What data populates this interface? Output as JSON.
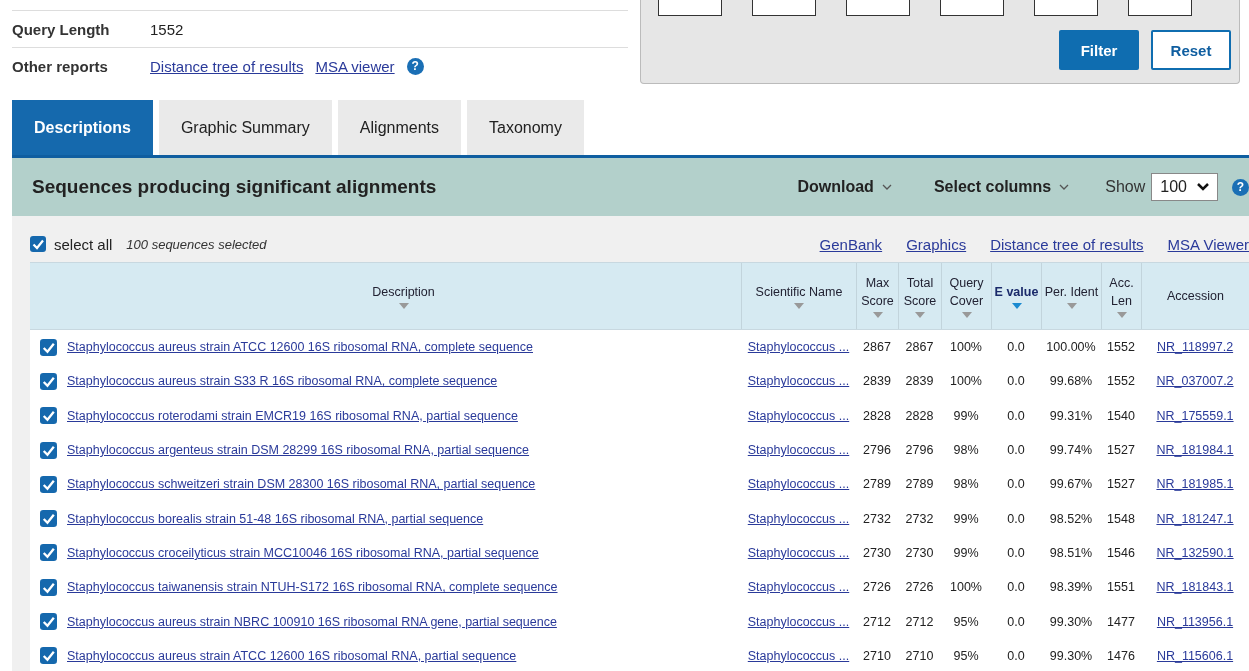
{
  "summary": [
    {
      "label": "Query Length",
      "value": "1552"
    },
    {
      "label": "Other reports",
      "links": [
        "Distance tree of results",
        "MSA viewer"
      ],
      "help": "?"
    }
  ],
  "filter_panel": {
    "buttons": [
      {
        "label": "Filter",
        "kind": "primary"
      },
      {
        "label": "Reset",
        "kind": "secondary"
      }
    ]
  },
  "tabs": [
    {
      "label": "Descriptions",
      "selected": true
    },
    {
      "label": "Graphic Summary",
      "selected": false
    },
    {
      "label": "Alignments",
      "selected": false
    },
    {
      "label": "Taxonomy",
      "selected": false
    }
  ],
  "results_header": {
    "title": "Sequences producing significant alignments",
    "download": "Download",
    "select_columns": "Select columns",
    "show_label": "Show",
    "show_value": "100",
    "help": "?"
  },
  "select_all": {
    "label": "select all",
    "checked": true,
    "count": "100 sequences selected",
    "links": [
      "GenBank",
      "Graphics",
      "Distance tree of results",
      "MSA Viewer"
    ]
  },
  "table": {
    "columns": [
      {
        "label": "Description",
        "sorted": false
      },
      {
        "label": "Scientific Name",
        "sorted": false
      },
      {
        "label": "Max Score",
        "sorted": false
      },
      {
        "label": "Total Score",
        "sorted": false
      },
      {
        "label": "Query Cover",
        "sorted": false
      },
      {
        "label": "E value",
        "sorted": true
      },
      {
        "label": "Per. Ident",
        "sorted": false
      },
      {
        "label": "Acc. Len",
        "sorted": false
      },
      {
        "label": "Accession",
        "sorted": false,
        "arrow": false
      }
    ],
    "rows": [
      {
        "checked": true,
        "cells": [
          "Staphylococcus aureus strain ATCC 12600 16S ribosomal RNA, complete sequence",
          "Staphylococcus ...",
          "2867",
          "2867",
          "100%",
          "0.0",
          "100.00%",
          "1552",
          "NR_118997.2"
        ]
      },
      {
        "checked": true,
        "cells": [
          "Staphylococcus aureus strain S33 R 16S ribosomal RNA, complete sequence",
          "Staphylococcus ...",
          "2839",
          "2839",
          "100%",
          "0.0",
          "99.68%",
          "1552",
          "NR_037007.2"
        ]
      },
      {
        "checked": true,
        "cells": [
          "Staphylococcus roterodami strain EMCR19 16S ribosomal RNA, partial sequence",
          "Staphylococcus ...",
          "2828",
          "2828",
          "99%",
          "0.0",
          "99.31%",
          "1540",
          "NR_175559.1"
        ]
      },
      {
        "checked": true,
        "cells": [
          "Staphylococcus argenteus strain DSM 28299 16S ribosomal RNA, partial sequence",
          "Staphylococcus ...",
          "2796",
          "2796",
          "98%",
          "0.0",
          "99.74%",
          "1527",
          "NR_181984.1"
        ]
      },
      {
        "checked": true,
        "cells": [
          "Staphylococcus schweitzeri strain DSM 28300 16S ribosomal RNA, partial sequence",
          "Staphylococcus ...",
          "2789",
          "2789",
          "98%",
          "0.0",
          "99.67%",
          "1527",
          "NR_181985.1"
        ]
      },
      {
        "checked": true,
        "cells": [
          "Staphylococcus borealis strain 51-48 16S ribosomal RNA, partial sequence",
          "Staphylococcus ...",
          "2732",
          "2732",
          "99%",
          "0.0",
          "98.52%",
          "1548",
          "NR_181247.1"
        ]
      },
      {
        "checked": true,
        "cells": [
          "Staphylococcus croceilyticus strain MCC10046 16S ribosomal RNA, partial sequence",
          "Staphylococcus ...",
          "2730",
          "2730",
          "99%",
          "0.0",
          "98.51%",
          "1546",
          "NR_132590.1"
        ]
      },
      {
        "checked": true,
        "cells": [
          "Staphylococcus taiwanensis strain NTUH-S172 16S ribosomal RNA, complete sequence",
          "Staphylococcus ...",
          "2726",
          "2726",
          "100%",
          "0.0",
          "98.39%",
          "1551",
          "NR_181843.1"
        ]
      },
      {
        "checked": true,
        "cells": [
          "Staphylococcus aureus strain NBRC 100910 16S ribosomal RNA gene, partial sequence",
          "Staphylococcus ...",
          "2712",
          "2712",
          "95%",
          "0.0",
          "99.30%",
          "1477",
          "NR_113956.1"
        ]
      },
      {
        "checked": true,
        "cells": [
          "Staphylococcus aureus strain ATCC 12600 16S ribosomal RNA, partial sequence",
          "Staphylococcus ...",
          "2710",
          "2710",
          "95%",
          "0.0",
          "99.30%",
          "1476",
          "NR_115606.1"
        ]
      }
    ]
  }
}
